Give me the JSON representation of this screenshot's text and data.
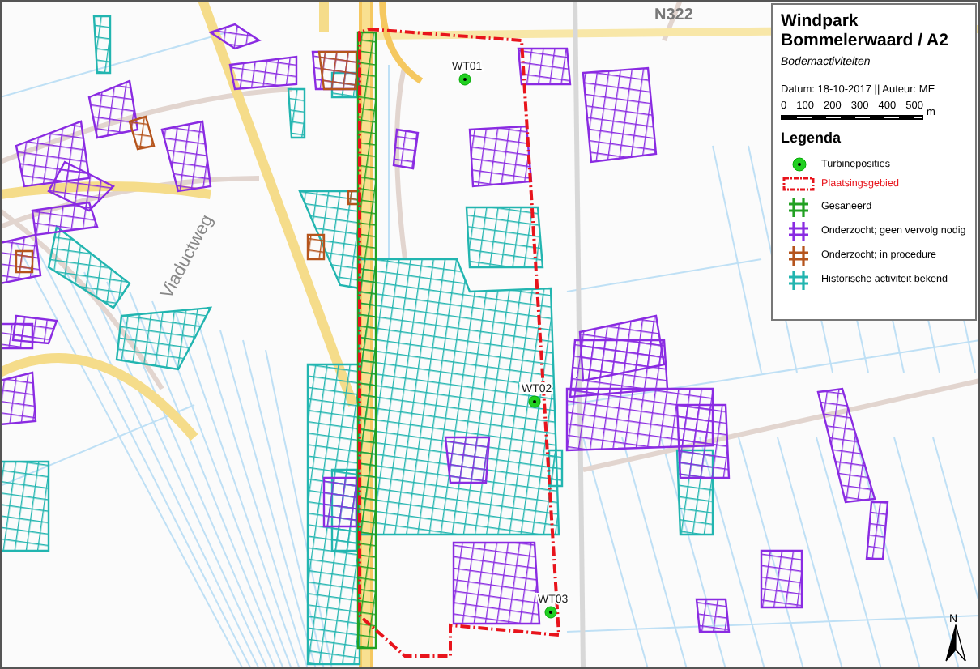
{
  "map": {
    "road_labels": [
      {
        "text": "Viaductweg"
      },
      {
        "text": "N322"
      }
    ],
    "turbines": [
      {
        "label": "WT01"
      },
      {
        "label": "WT02"
      },
      {
        "label": "WT03"
      }
    ],
    "north_arrow": {
      "label": "N"
    }
  },
  "legend_panel": {
    "title": "Windpark Bommelerwaard / A2",
    "subtitle": "Bodemactiviteiten",
    "meta": "Datum: 18-10-2017 || Auteur: ME",
    "scale_bar": {
      "ticks": [
        "0",
        "100",
        "200",
        "300",
        "400",
        "500"
      ],
      "unit": "m"
    },
    "heading": "Legenda",
    "items": [
      {
        "kind": "point",
        "label": "Turbineposities"
      },
      {
        "kind": "outline",
        "label": "Plaatsingsgebied",
        "color": "#e8141c"
      },
      {
        "kind": "hatch",
        "label": "Gesaneerd",
        "color": "#22a022"
      },
      {
        "kind": "hatch",
        "label": "Onderzocht; geen vervolg nodig",
        "color": "#8a2be2"
      },
      {
        "kind": "hatch",
        "label": "Onderzocht; in procedure",
        "color": "#b5541c"
      },
      {
        "kind": "hatch",
        "label": "Historische activiteit bekend",
        "color": "#22b5b0"
      }
    ]
  }
}
